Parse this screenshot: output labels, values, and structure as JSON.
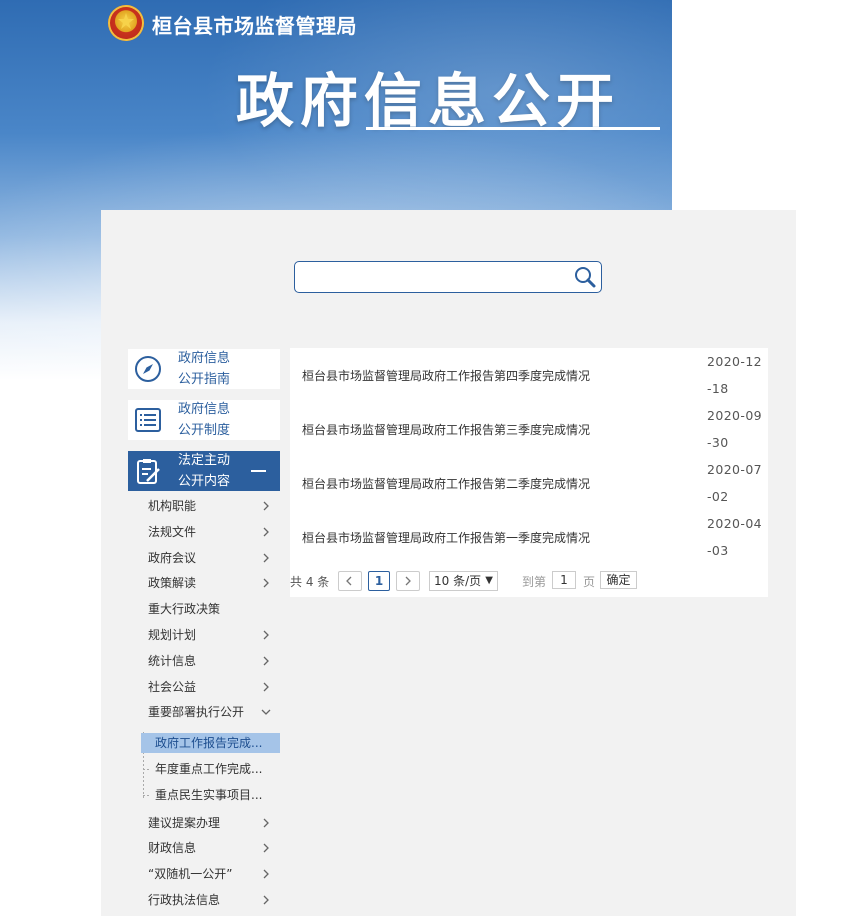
{
  "header": {
    "org_name": "桓台县市场监督管理局",
    "title": "政府信息公开"
  },
  "search": {
    "value": "",
    "placeholder": "",
    "icon": "search-icon"
  },
  "sidebar": {
    "cards": [
      {
        "label_line1": "政府信息",
        "label_line2": "公开指南",
        "icon": "compass-icon",
        "active": false
      },
      {
        "label_line1": "政府信息",
        "label_line2": "公开制度",
        "icon": "document-list-icon",
        "active": false
      },
      {
        "label_line1": "法定主动",
        "label_line2": "公开内容",
        "icon": "clipboard-edit-icon",
        "active": true
      }
    ],
    "items": [
      {
        "label": "机构职能",
        "chevron": "right"
      },
      {
        "label": "法规文件",
        "chevron": "right"
      },
      {
        "label": "政府会议",
        "chevron": "right"
      },
      {
        "label": "政策解读",
        "chevron": "right"
      },
      {
        "label": "重大行政决策",
        "chevron": "none"
      },
      {
        "label": "规划计划",
        "chevron": "right"
      },
      {
        "label": "统计信息",
        "chevron": "right"
      },
      {
        "label": "社会公益",
        "chevron": "right"
      },
      {
        "label": "重要部署执行公开",
        "chevron": "down"
      },
      {
        "label": "建议提案办理",
        "chevron": "right"
      },
      {
        "label": "财政信息",
        "chevron": "right"
      },
      {
        "label": "“双随机一公开”",
        "chevron": "right"
      },
      {
        "label": "行政执法信息",
        "chevron": "right"
      }
    ],
    "subitems": [
      {
        "label": "政府工作报告完成...",
        "selected": true
      },
      {
        "label": "年度重点工作完成...",
        "selected": false
      },
      {
        "label": "重点民生实事项目...",
        "selected": false
      }
    ]
  },
  "list": {
    "rows": [
      {
        "title": "桓台县市场监督管理局政府工作报告第四季度完成情况",
        "date": "2020-12-18"
      },
      {
        "title": "桓台县市场监督管理局政府工作报告第三季度完成情况",
        "date": "2020-09-30"
      },
      {
        "title": "桓台县市场监督管理局政府工作报告第二季度完成情况",
        "date": "2020-07-02"
      },
      {
        "title": "桓台县市场监督管理局政府工作报告第一季度完成情况",
        "date": "2020-04-03"
      }
    ]
  },
  "pager": {
    "total": "共 4 条",
    "current_page": "1",
    "page_size": "10 条/页",
    "goto_label": "到第",
    "goto_value": "1",
    "page_unit": "页",
    "confirm": "确定"
  },
  "colors": {
    "accent": "#2c5f9e",
    "selected_bg": "#a5c4e8",
    "panel_bg": "#f2f2f2"
  }
}
